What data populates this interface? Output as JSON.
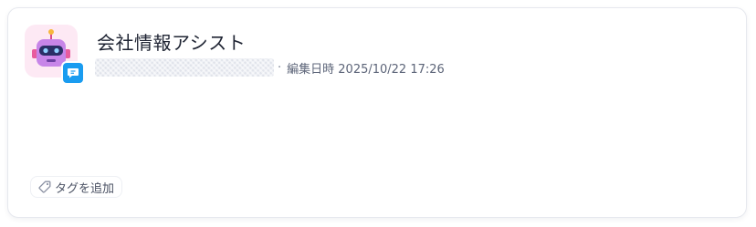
{
  "card": {
    "title": "会社情報アシスト",
    "owner_redacted": "",
    "separator": "·",
    "edited_label": "編集日時 2025/10/22 17:26",
    "tag_button_label": "タグを追加"
  },
  "icons": {
    "avatar": "robot-icon",
    "badge": "chat-bubble-icon",
    "tag": "tag-icon"
  },
  "colors": {
    "avatar_bg": "#fde9f4",
    "badge_bg": "#1a9cf0",
    "title_text": "#1f2433",
    "meta_text": "#5c6478"
  }
}
